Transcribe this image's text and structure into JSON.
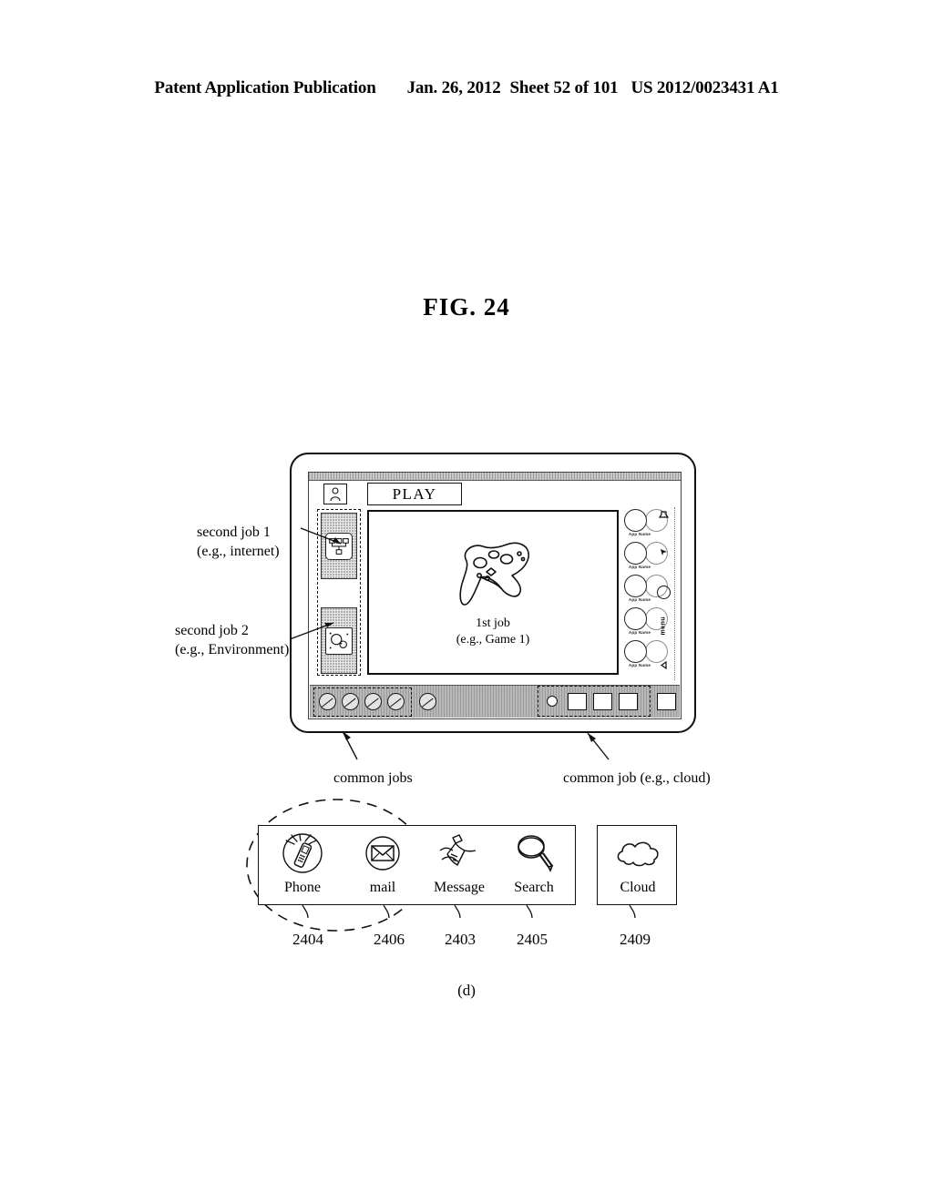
{
  "header": {
    "publication": "Patent Application Publication",
    "date": "Jan. 26, 2012",
    "sheet": "Sheet 52 of 101",
    "docnum": "US 2012/0023431 A1"
  },
  "figure": {
    "title": "FIG. 24",
    "subfigure_caption": "(d)"
  },
  "device": {
    "tab_label": "PLAY",
    "avatar_icon": "person-icon",
    "main_job": {
      "line1": "1st job",
      "line2": "(e.g., Game 1)",
      "art_icon": "game-controller-icon"
    },
    "sidebar": {
      "items": [
        {
          "icon": "network-icon",
          "annotation_line1": "second job 1",
          "annotation_line2": "(e.g., internet)"
        },
        {
          "icon": "search-globe-icon",
          "annotation_line1": "second job 2",
          "annotation_line2": "(e.g., Environment)"
        }
      ]
    },
    "app_list": [
      {
        "name": "App Name",
        "icon": "app-circle-icon"
      },
      {
        "name": "App Name",
        "icon": "app-circle-icon"
      },
      {
        "name": "App Name",
        "icon": "app-circle-icon"
      },
      {
        "name": "App Name",
        "icon": "app-circle-icon"
      },
      {
        "name": "App Name",
        "icon": "app-circle-icon"
      }
    ],
    "edge_controls": [
      {
        "icon": "volume-glyph-icon",
        "label": ""
      },
      {
        "icon": "pointer-glyph-icon",
        "label": ""
      },
      {
        "icon": "home-circle-icon",
        "label": ""
      },
      {
        "icon": "menu-icon",
        "label": "menu"
      },
      {
        "icon": "back-glyph-icon",
        "label": ""
      }
    ],
    "dock": {
      "left_group_count": 4,
      "left_extra_count": 1,
      "right_group": {
        "dot_count": 1,
        "square_count": 3
      },
      "right_extra_square_count": 1
    }
  },
  "annotations": {
    "second_job_1": {
      "line1": "second job 1",
      "line2": "(e.g., internet)"
    },
    "second_job_2": {
      "line1": "second job 2",
      "line2": "(e.g., Environment)"
    },
    "common_jobs": "common jobs",
    "common_job_cloud": "common job (e.g., cloud)"
  },
  "common_jobs_panel": {
    "items": [
      {
        "label": "Phone",
        "icon": "cellphone-antenna-icon",
        "ref": "2404"
      },
      {
        "label": "mail",
        "icon": "envelope-icon",
        "ref": "2406"
      },
      {
        "label": "Message",
        "icon": "note-write-icon",
        "ref": "2403"
      },
      {
        "label": "Search",
        "icon": "magnifier-icon",
        "ref": "2405"
      }
    ]
  },
  "cloud_panel": {
    "label": "Cloud",
    "icon": "cloud-icon",
    "ref": "2409"
  }
}
